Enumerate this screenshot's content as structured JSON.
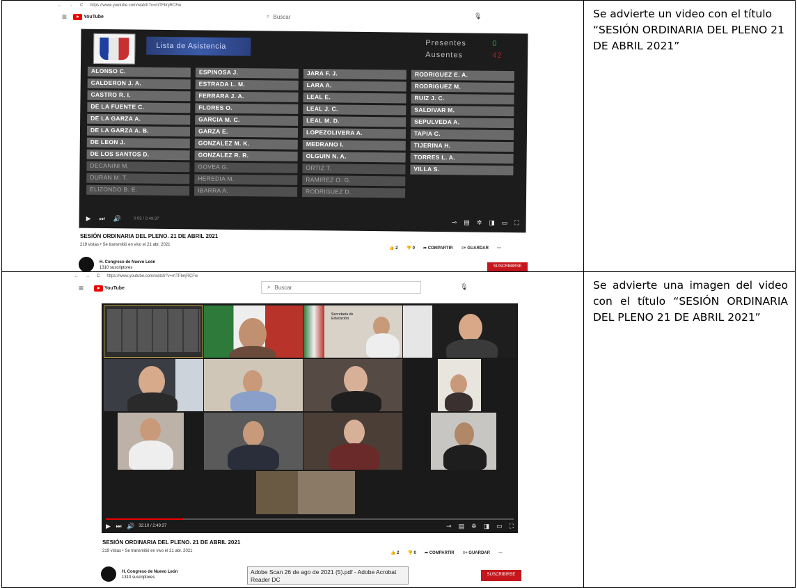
{
  "rows": [
    {
      "description": "Se advierte un video con el título “SESIÓN ORDINARIA DEL PLENO 21 DE ABRIL 2021”",
      "screenshot": {
        "url": "https://www.youtube.com/watch?v=mTFbnjRCFw",
        "logo": "YouTube",
        "search_placeholder": "Buscar",
        "player": {
          "list_title": "Lista de Asistencia",
          "presentes_label": "Presentes",
          "ausentes_label": "Ausentes",
          "presentes_count": "0",
          "ausentes_count": "42",
          "columns": [
            [
              "ALONSO C.",
              "CALDERON J. A.",
              "CASTRO R. I.",
              "DE LA FUENTE C.",
              "DE LA GARZA A.",
              "DE LA GARZA A. B.",
              "DE LEON J.",
              "DE LOS SANTOS D.",
              "DECANINI M.",
              "DURAN M. T.",
              "ELIZONDO B. E."
            ],
            [
              "ESPINOSA J.",
              "ESTRADA L. M.",
              "FERRARA J. A.",
              "FLORES O.",
              "GARCIA M. C.",
              "GARZA E.",
              "GONZALEZ M. K.",
              "GONZALEZ R. R.",
              "GOVEA G.",
              "HEREDIA M.",
              "IBARRA A."
            ],
            [
              "JARA F. J.",
              "LARA A.",
              "LEAL E.",
              "LEAL J. C.",
              "LEAL M. D.",
              "LOPEZOLIVERA A.",
              "MEDRANO I.",
              "OLGUIN N. A.",
              "ORTIZ T.",
              "RAMIREZ O. G.",
              "RODRIGUEZ D."
            ],
            [
              "RODRIGUEZ E. A.",
              "RODRIGUEZ M.",
              "RUIZ J. C.",
              "SALDIVAR M.",
              "SEPULVEDA A.",
              "TAPIA C.",
              "TIJERINA H.",
              "TORRES L. A.",
              "VILLA S."
            ]
          ],
          "time": "0:05 / 2:49:37"
        },
        "video_title": "SESIÓN ORDINARIA DEL PLENO. 21 DE ABRIL 2021",
        "video_meta": "219 vistas • Se transmitió en vivo el 21 abr. 2021",
        "likes": "2",
        "dislikes": "0",
        "share_label": "COMPARTIR",
        "save_label": "GUARDAR",
        "channel_name": "H. Congreso de Nuevo León",
        "channel_subs": "1310 suscriptores",
        "subscribe_label": "SUSCRIBIRSE"
      }
    },
    {
      "description": "Se advierte una imagen del video con el título “SESIÓN ORDINARIA DEL PLENO 21 DE ABRIL 2021”",
      "screenshot": {
        "url": "https://www.youtube.com/watch?v=mTFbnjRCFw",
        "logo": "YouTube",
        "search_placeholder": "Buscar",
        "player": {
          "time": "32:10 / 2:49:37",
          "progress": 0.19,
          "sign_text": "Secretaría de Educación"
        },
        "video_title": "SESIÓN ORDINARIA DEL PLENO. 21 DE ABRIL 2021",
        "video_meta": "219 vistas • Se transmitió en vivo el 21 abr. 2021",
        "likes": "2",
        "dislikes": "0",
        "share_label": "COMPARTIR",
        "save_label": "GUARDAR",
        "channel_name": "H. Congreso de Nuevo León",
        "channel_subs": "1310 suscriptores",
        "subscribe_label": "SUSCRIBIRSE",
        "tooltip": "Adobe Scan 26 de ago de 2021 (5).pdf - Adobe Acrobat Reader DC"
      }
    }
  ],
  "colors": {
    "youtube_red": "#ff0000",
    "subscribe_red": "#c4161c",
    "presentes_green": "#1fa33a",
    "ausentes_red": "#b42020"
  }
}
